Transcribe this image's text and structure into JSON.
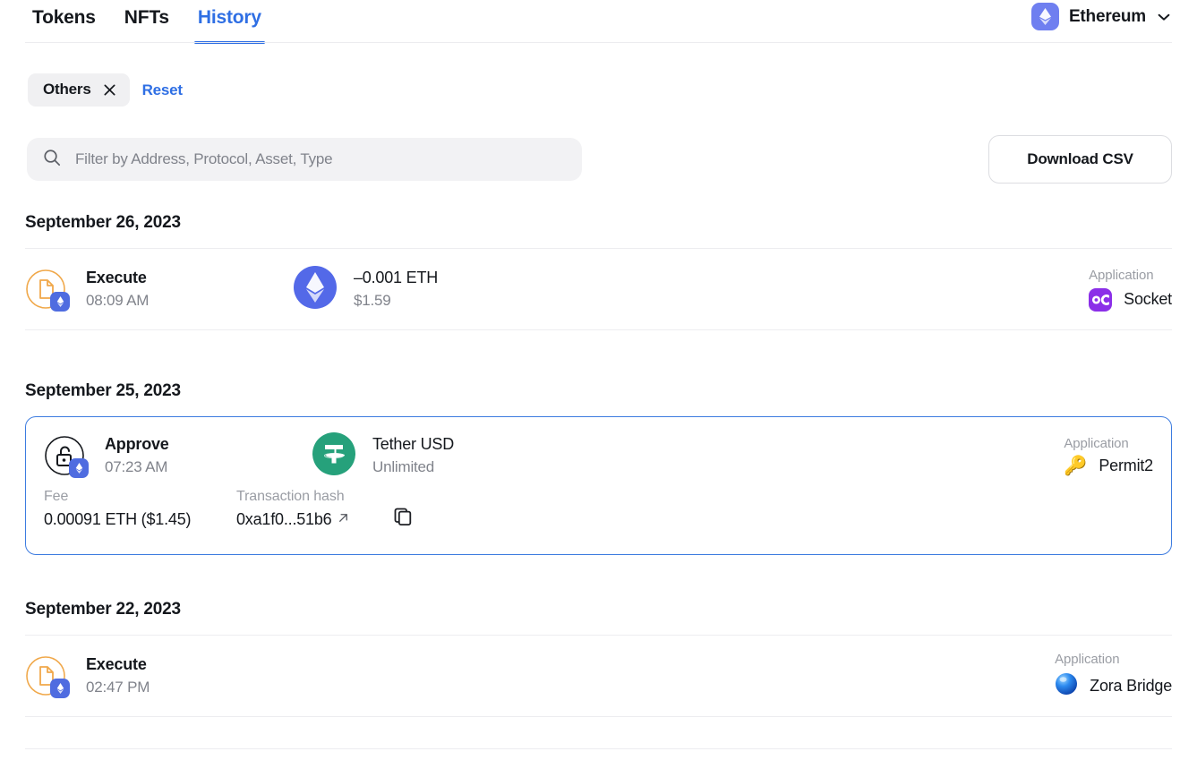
{
  "tabs": [
    {
      "label": "Tokens",
      "active": false
    },
    {
      "label": "NFTs",
      "active": false
    },
    {
      "label": "History",
      "active": true
    }
  ],
  "network": {
    "name": "Ethereum",
    "icon": "ethereum-icon",
    "chevron": "chevron-down-icon",
    "color": "#6f7ff0"
  },
  "filters": {
    "chip_label": "Others",
    "chip_close_icon": "close-icon",
    "reset_label": "Reset",
    "reset_color": "#2f6fe4"
  },
  "search": {
    "placeholder": "Filter by Address, Protocol, Asset, Type",
    "value": "",
    "icon": "search-icon"
  },
  "download": {
    "label": "Download CSV"
  },
  "accent": "#2f6fe4",
  "groups": [
    {
      "date": "September 26, 2023",
      "rows": [
        {
          "expanded": false,
          "op_icon": "document-execute-icon",
          "op_icon_color": "#f0a84a",
          "badge_icon": "ethereum-icon",
          "operation": "Execute",
          "time": "08:09 AM",
          "asset_icon": "ethereum-token-icon",
          "asset_amount": "–0.001 ETH",
          "asset_sub": "$1.59",
          "app_label": "Application",
          "app_icon": "socket-icon",
          "app_name": "Socket"
        }
      ]
    },
    {
      "date": "September 25, 2023",
      "rows": [
        {
          "expanded": true,
          "op_icon": "unlock-padlock-icon",
          "op_icon_color": "#15181d",
          "badge_icon": "ethereum-icon",
          "operation": "Approve",
          "time": "07:23 AM",
          "asset_icon": "tether-icon",
          "asset_amount": "Tether USD",
          "asset_sub": "Unlimited",
          "app_label": "Application",
          "app_icon": "key-icon",
          "app_name": "Permit2",
          "details": {
            "fee_label": "Fee",
            "fee_value": "0.00091 ETH ($1.45)",
            "hash_label": "Transaction hash",
            "hash_value": "0xa1f0...51b6",
            "external_icon": "external-link-icon",
            "copy_icon": "copy-icon"
          }
        }
      ]
    },
    {
      "date": "September 22, 2023",
      "rows": [
        {
          "expanded": false,
          "op_icon": "document-execute-icon",
          "op_icon_color": "#f0a84a",
          "badge_icon": "ethereum-icon",
          "operation": "Execute",
          "time": "02:47 PM",
          "asset_icon": "",
          "asset_amount": "",
          "asset_sub": "",
          "app_label": "Application",
          "app_icon": "zora-icon",
          "app_name": "Zora Bridge"
        }
      ]
    }
  ]
}
